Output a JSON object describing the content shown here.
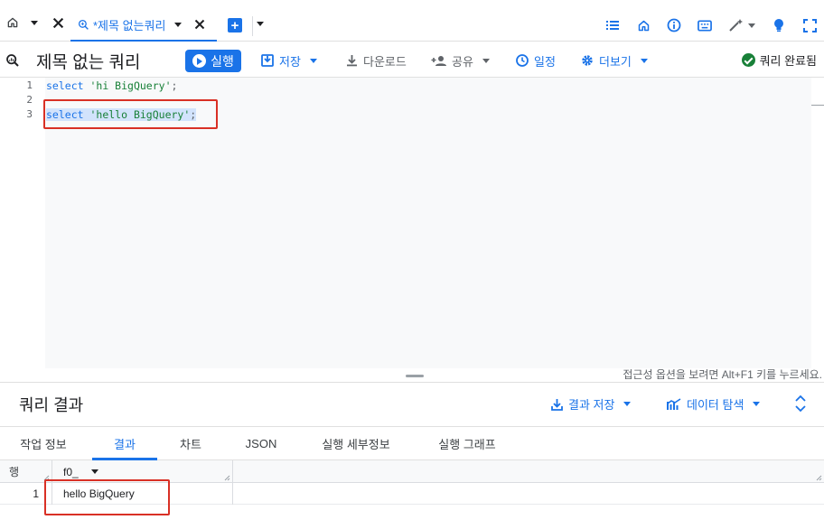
{
  "tabbar": {
    "active_tab_title": "*제목 없는쿼리"
  },
  "toolbar": {
    "title": "제목 없는 쿼리",
    "run_label": "실행",
    "save_label": "저장",
    "download_label": "다운로드",
    "share_label": "공유",
    "schedule_label": "일정",
    "more_label": "더보기",
    "status_label": "쿼리 완료됨"
  },
  "editor": {
    "line_numbers": [
      "1",
      "2",
      "3"
    ],
    "lines": [
      {
        "keyword": "select",
        "string": "'hi BigQuery'",
        "end": ";"
      },
      {
        "keyword": "",
        "string": "",
        "end": ""
      },
      {
        "keyword": "select",
        "string": "'hello BigQuery'",
        "end": ";"
      }
    ],
    "accessibility_hint": "접근성 옵션을 보려면 Alt+F1 키를 누르세요."
  },
  "results": {
    "title": "쿼리 결과",
    "save_results_label": "결과 저장",
    "explore_data_label": "데이터 탐색",
    "tabs": [
      {
        "label": "작업 정보"
      },
      {
        "label": "결과"
      },
      {
        "label": "차트"
      },
      {
        "label": "JSON"
      },
      {
        "label": "실행 세부정보"
      },
      {
        "label": "실행 그래프"
      }
    ],
    "active_tab": "결과",
    "grid": {
      "row_header": "행",
      "column_header": "f0_",
      "rows": [
        {
          "row_number": "1",
          "value": "hello BigQuery"
        }
      ]
    }
  },
  "colors": {
    "accent": "#1a73e8",
    "success": "#188038",
    "highlight_border": "#d93025",
    "selection": "#d2e3fc"
  },
  "icons": [
    "home-icon",
    "close-icon",
    "query-icon",
    "add-tab-icon",
    "list-icon",
    "home-icon",
    "info-icon",
    "keyboard-icon",
    "magic-wand-icon",
    "lightbulb-icon",
    "fullscreen-icon",
    "play-icon",
    "save-icon",
    "download-icon",
    "person-add-icon",
    "clock-icon",
    "gear-icon",
    "check-circle-icon",
    "chart-icon",
    "expand-icon"
  ]
}
